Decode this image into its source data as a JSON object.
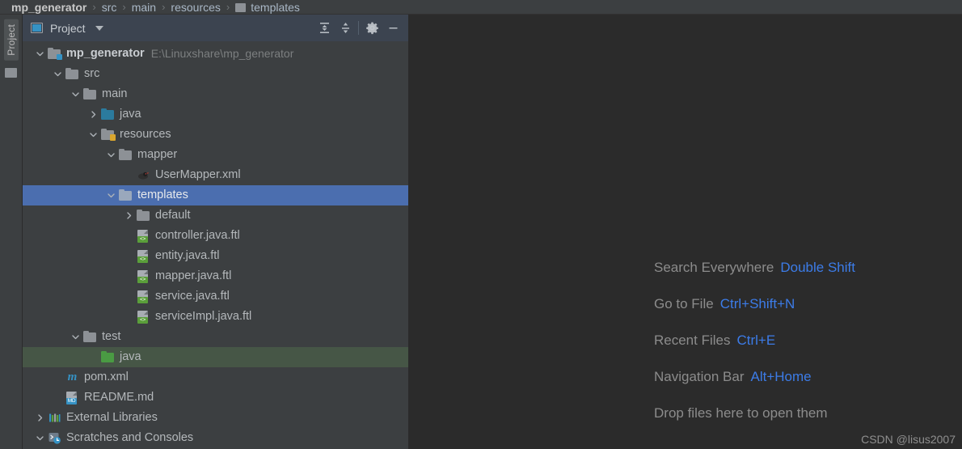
{
  "breadcrumb": {
    "separator": "›",
    "items": [
      {
        "label": "mp_generator",
        "bold": true,
        "icon": "none"
      },
      {
        "label": "src",
        "bold": false,
        "icon": "none"
      },
      {
        "label": "main",
        "bold": false,
        "icon": "none"
      },
      {
        "label": "resources",
        "bold": false,
        "icon": "none"
      },
      {
        "label": "templates",
        "bold": false,
        "icon": "folder-icon"
      }
    ]
  },
  "toolstrip": {
    "tab_label": "Project",
    "folder_icon": "folder-icon"
  },
  "panel": {
    "title": "Project",
    "window_icon": "project-pane-icon",
    "dropdown_icon": "chevron-down-icon",
    "actions": [
      {
        "name": "expand-all-button",
        "icon": "expand-all-icon"
      },
      {
        "name": "collapse-all-button",
        "icon": "collapse-all-icon"
      },
      {
        "name": "settings-button",
        "icon": "gear-icon"
      },
      {
        "name": "hide-button",
        "icon": "minimize-icon"
      }
    ]
  },
  "tree": {
    "nodes": [
      {
        "label": "mp_generator",
        "path": "E:\\Linuxshare\\mp_generator",
        "depth": 0,
        "arrow": "down",
        "icon": "module-folder-icon",
        "bold": true,
        "state": "normal"
      },
      {
        "label": "src",
        "path": "",
        "depth": 1,
        "arrow": "down",
        "icon": "folder-icon",
        "bold": false,
        "state": "normal"
      },
      {
        "label": "main",
        "path": "",
        "depth": 2,
        "arrow": "down",
        "icon": "folder-icon",
        "bold": false,
        "state": "normal"
      },
      {
        "label": "java",
        "path": "",
        "depth": 3,
        "arrow": "right",
        "icon": "source-folder-icon",
        "bold": false,
        "state": "normal"
      },
      {
        "label": "resources",
        "path": "",
        "depth": 3,
        "arrow": "down",
        "icon": "resources-folder-icon",
        "bold": false,
        "state": "normal"
      },
      {
        "label": "mapper",
        "path": "",
        "depth": 4,
        "arrow": "down",
        "icon": "folder-icon",
        "bold": false,
        "state": "normal"
      },
      {
        "label": "UserMapper.xml",
        "path": "",
        "depth": 5,
        "arrow": "none",
        "icon": "mybatis-file-icon",
        "bold": false,
        "state": "normal"
      },
      {
        "label": "templates",
        "path": "",
        "depth": 4,
        "arrow": "down",
        "icon": "folder-light-icon",
        "bold": false,
        "state": "selected"
      },
      {
        "label": "default",
        "path": "",
        "depth": 5,
        "arrow": "right",
        "icon": "folder-icon",
        "bold": false,
        "state": "normal"
      },
      {
        "label": "controller.java.ftl",
        "path": "",
        "depth": 5,
        "arrow": "none",
        "icon": "ftl-file-icon",
        "bold": false,
        "state": "normal"
      },
      {
        "label": "entity.java.ftl",
        "path": "",
        "depth": 5,
        "arrow": "none",
        "icon": "ftl-file-icon",
        "bold": false,
        "state": "normal"
      },
      {
        "label": "mapper.java.ftl",
        "path": "",
        "depth": 5,
        "arrow": "none",
        "icon": "ftl-file-icon",
        "bold": false,
        "state": "normal"
      },
      {
        "label": "service.java.ftl",
        "path": "",
        "depth": 5,
        "arrow": "none",
        "icon": "ftl-file-icon",
        "bold": false,
        "state": "normal"
      },
      {
        "label": "serviceImpl.java.ftl",
        "path": "",
        "depth": 5,
        "arrow": "none",
        "icon": "ftl-file-icon",
        "bold": false,
        "state": "normal"
      },
      {
        "label": "test",
        "path": "",
        "depth": 2,
        "arrow": "down",
        "icon": "folder-icon",
        "bold": false,
        "state": "normal"
      },
      {
        "label": "java",
        "path": "",
        "depth": 3,
        "arrow": "none",
        "icon": "test-folder-icon",
        "bold": false,
        "state": "testroot"
      },
      {
        "label": "pom.xml",
        "path": "",
        "depth": 1,
        "arrow": "none",
        "icon": "maven-file-icon",
        "bold": false,
        "state": "normal"
      },
      {
        "label": "README.md",
        "path": "",
        "depth": 1,
        "arrow": "none",
        "icon": "markdown-file-icon",
        "bold": false,
        "state": "normal"
      },
      {
        "label": "External Libraries",
        "path": "",
        "depth": 0,
        "arrow": "right",
        "icon": "libraries-icon",
        "bold": false,
        "state": "normal"
      },
      {
        "label": "Scratches and Consoles",
        "path": "",
        "depth": 0,
        "arrow": "down",
        "icon": "scratches-icon",
        "bold": false,
        "state": "normal"
      }
    ]
  },
  "editor": {
    "hints": [
      {
        "action": "Search Everywhere",
        "shortcut": "Double Shift"
      },
      {
        "action": "Go to File",
        "shortcut": "Ctrl+Shift+N"
      },
      {
        "action": "Recent Files",
        "shortcut": "Ctrl+E"
      },
      {
        "action": "Navigation Bar",
        "shortcut": "Alt+Home"
      },
      {
        "action": "Drop files here to open them",
        "shortcut": ""
      }
    ],
    "watermark": "CSDN @lisus2007"
  },
  "colors": {
    "panel_bg": "#3c3f41",
    "editor_bg": "#2b2b2b",
    "selection": "#4b6eaf",
    "test_root": "#465646",
    "accent_blue": "#3c7ce8",
    "header_bg": "#3c4450"
  }
}
